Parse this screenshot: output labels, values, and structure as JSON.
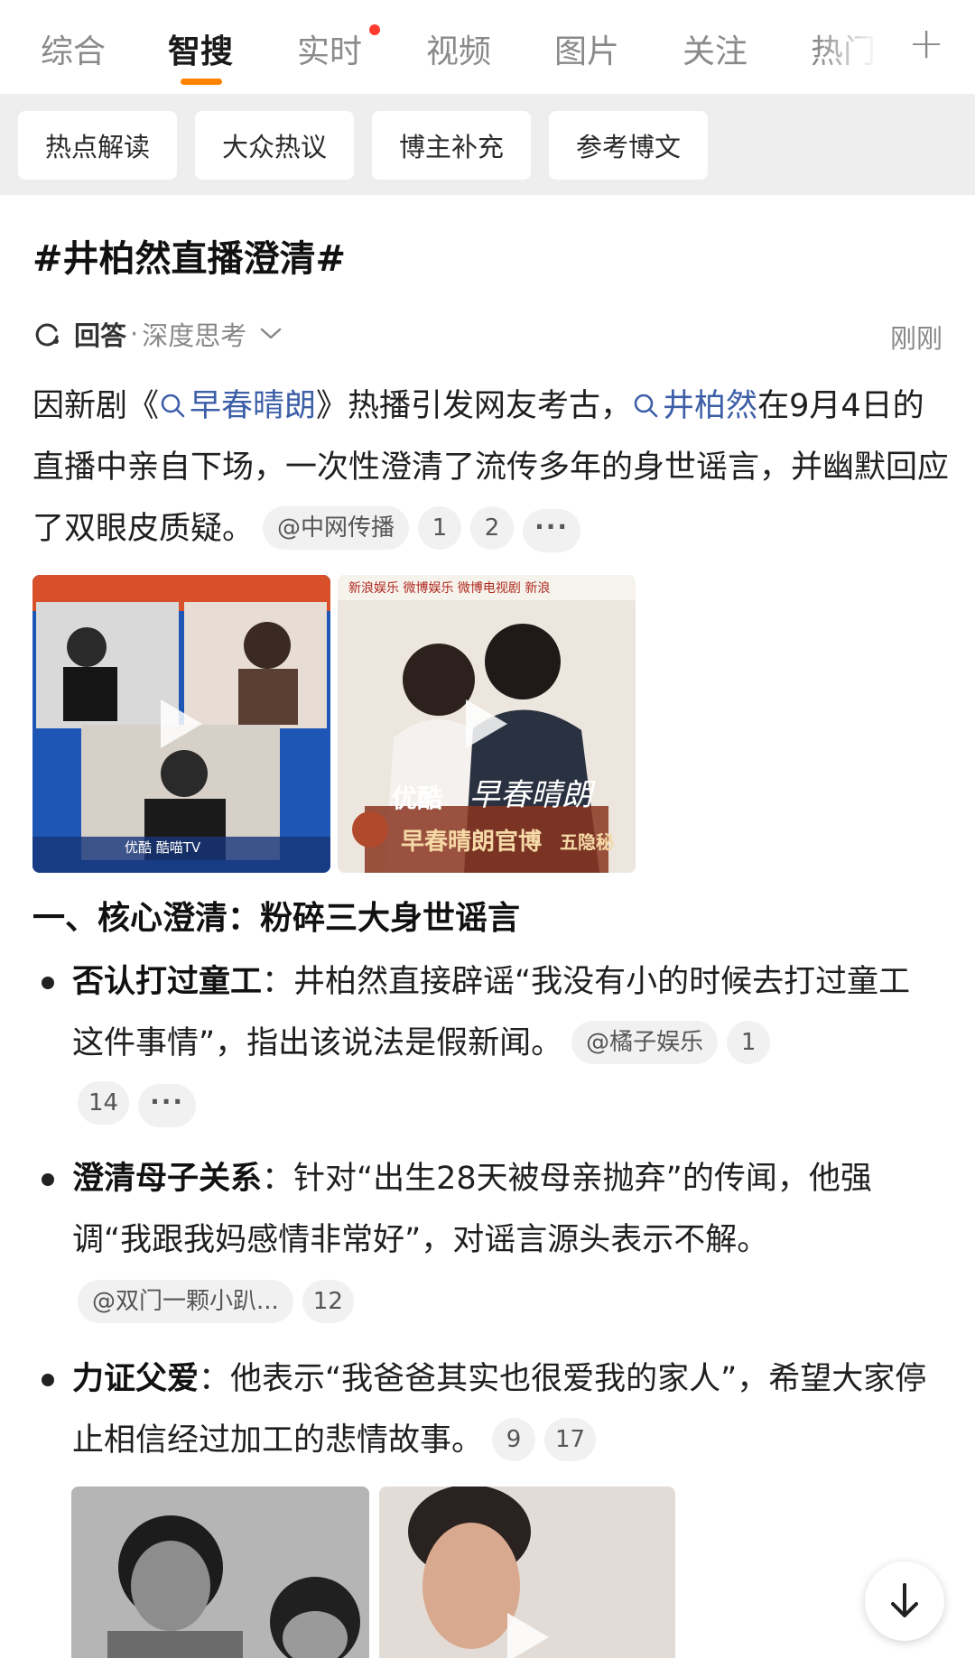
{
  "tabs": [
    {
      "label": "综合"
    },
    {
      "label": "智搜"
    },
    {
      "label": "实时"
    },
    {
      "label": "视频"
    },
    {
      "label": "图片"
    },
    {
      "label": "关注"
    },
    {
      "label": "热门"
    }
  ],
  "chips": [
    "热点解读",
    "大众热议",
    "博主补充",
    "参考博文"
  ],
  "topic": "#井柏然直播澄清#",
  "answer": {
    "label": "回答",
    "separator": "·",
    "mode": "深度思考",
    "time": "刚刚"
  },
  "intro": {
    "t1": "因新剧《",
    "link1": "早春晴朗",
    "t2": "》热播引发网友考古，",
    "link2": "井柏然",
    "t3": "在9月4日的直播中亲自下场，一次性澄清了流传多年的身世谣言，并幽默回应了双眼皮质疑。",
    "cite": "@中网传播",
    "refs": [
      "1",
      "2"
    ],
    "more": "···"
  },
  "thumbnails_1": {
    "left_caption": "优酷 酷喵TV",
    "right_header": "新浪娱乐  微博娱乐  微博电视剧  新浪",
    "right_brand": "优酷",
    "right_title_script": "早春晴朗",
    "right_caption": "早春晴朗官博",
    "right_caption_tail": "五隐秘"
  },
  "section1_title": "一、核心澄清：粉碎三大身世谣言",
  "bullets": [
    {
      "bold": "否认打过童工",
      "text": "：井柏然直接辟谣“我没有小的时候去打过童工这件事情”，指出该说法是假新闻。",
      "cite": "@橘子娱乐",
      "refs": [
        "1",
        "14"
      ],
      "more": "···"
    },
    {
      "bold": "澄清母子关系",
      "text": "：针对“出生28天被母亲抛弃”的传闻，他强调“我跟我妈感情非常好”，对谣言源头表示不解。",
      "cite": "@双门一颗小趴...",
      "refs": [
        "12"
      ]
    },
    {
      "bold": "力证父爱",
      "text": "：他表示“我爸爸其实也很爱我的家人”，希望大家停止相信经过加工的悲情故事。",
      "refs": [
        "9",
        "17"
      ]
    }
  ],
  "colors": {
    "accent": "#ff8200",
    "link": "#3d5fa8",
    "chip_bg": "#eeeeee",
    "red_dot": "#ff3b30"
  },
  "icons": {
    "answer": "refresh-spark-icon",
    "dropdown": "chevron-down-icon",
    "search_link": "search-icon",
    "scroll_down": "arrow-down-icon",
    "add_tab": "plus-icon"
  }
}
